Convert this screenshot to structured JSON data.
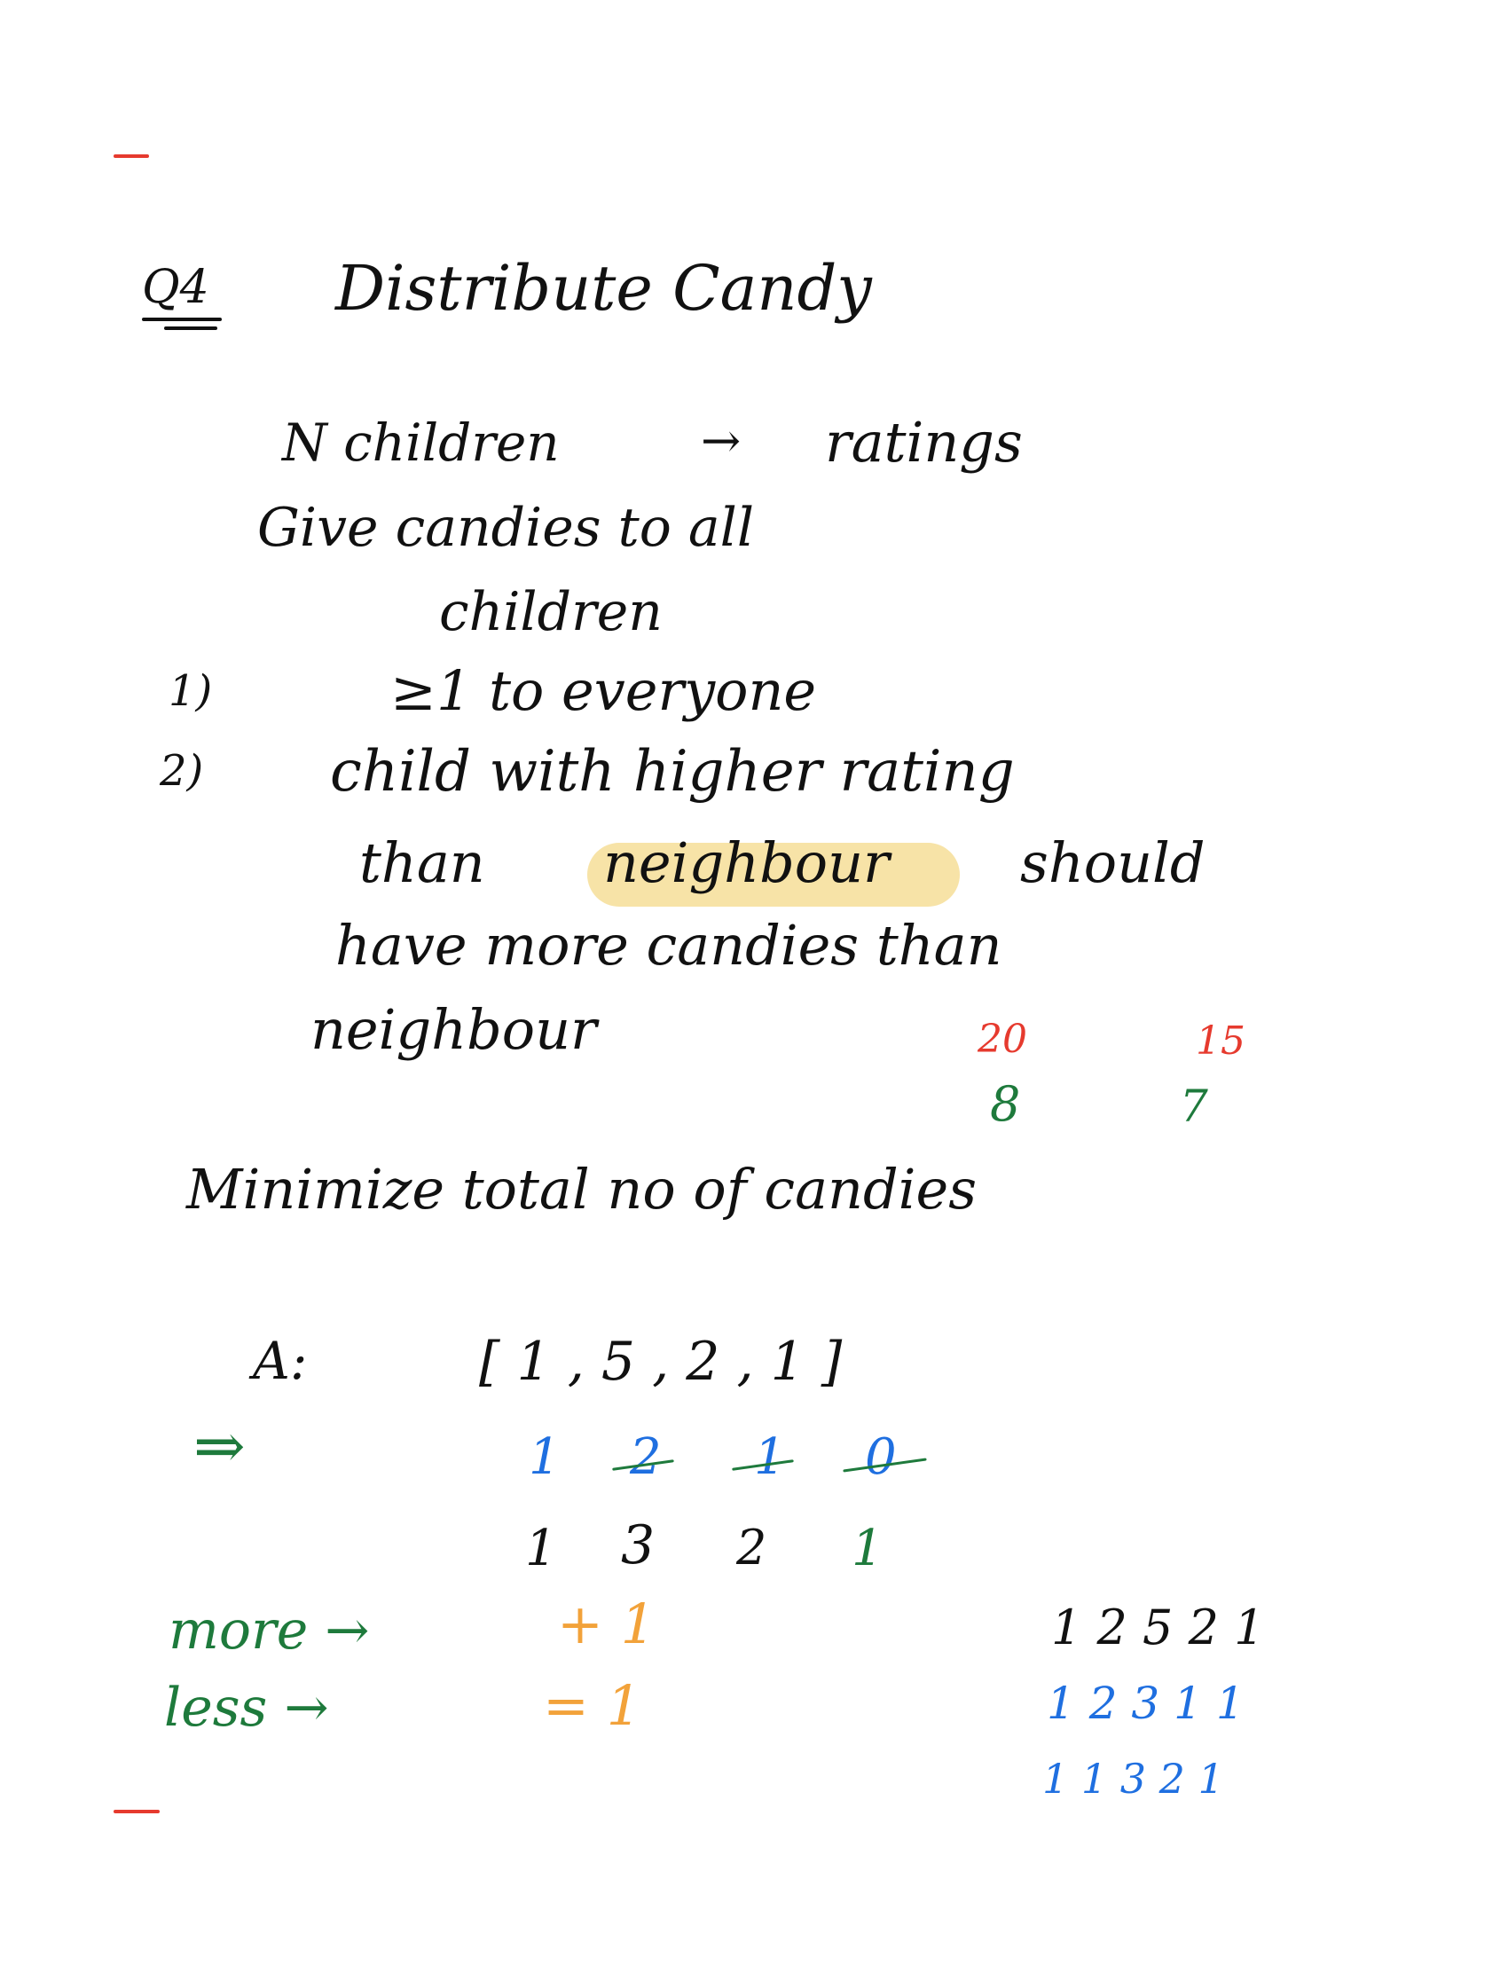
{
  "colors": {
    "ink": "#111111",
    "red": "#e63a2e",
    "green": "#1e7a3c",
    "blue": "#1f6fe0",
    "orange": "#f2a23a",
    "highlight": "#f4d98a"
  },
  "heading": {
    "number": "Q4",
    "title": "Distribute Candy"
  },
  "problem": {
    "line1": "N children",
    "arrow": "→",
    "line1_end": "ratings",
    "line2": "Give candies to all",
    "line3": "children"
  },
  "rules": {
    "r1_num": "1)",
    "r1_text": "≥1   to   everyone",
    "r2_num": "2)",
    "r2_line1": "child  with  higher  rating",
    "r2_line2_a": "than",
    "r2_line2_hl": "neighbour",
    "r2_line2_b": "should",
    "r2_line3": "have  more  candies  than",
    "r2_line4": "neighbour"
  },
  "side_example": {
    "ratings": [
      "20",
      "15"
    ],
    "candies": [
      "8",
      "7"
    ]
  },
  "goal": "Minimize  total  no  of  candies",
  "example": {
    "label": "A:",
    "array": "[ 1 , 5 , 2 , 1 ]",
    "implies": "⇒",
    "first_pass": [
      "1",
      "2",
      "1",
      "0"
    ],
    "final": [
      "1",
      "3",
      "2",
      "1"
    ]
  },
  "legend": {
    "more": "more →",
    "more_rule": "+ 1",
    "less": "less →",
    "less_rule": "= 1"
  },
  "second_example": {
    "ratings": "1  2 5  2 1",
    "pass1": "1   2 3   1 1",
    "pass2": "1   1   3   2 1"
  }
}
